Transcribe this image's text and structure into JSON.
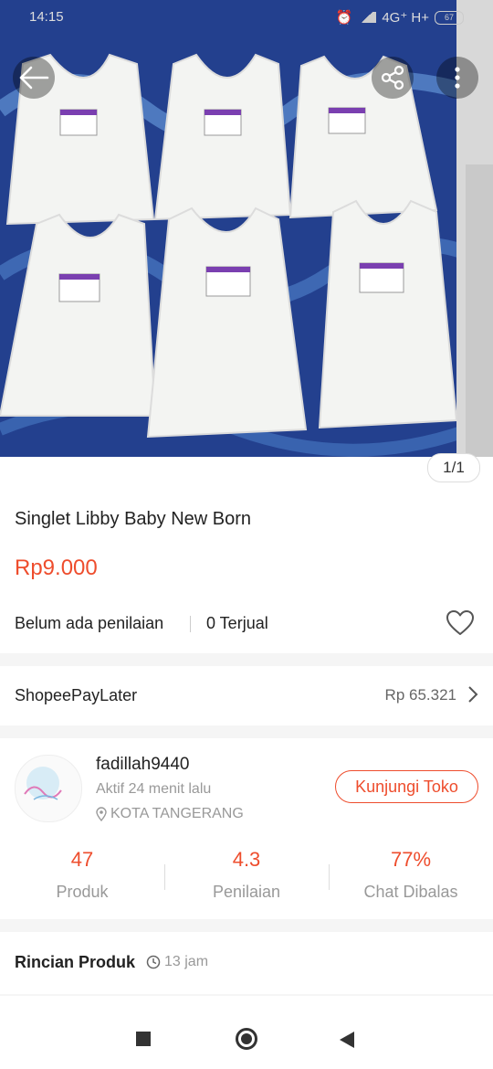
{
  "status_bar": {
    "time": "14:15",
    "network": "4G⁺ H+",
    "battery": "67"
  },
  "gallery": {
    "counter": "1/1"
  },
  "product": {
    "title": "Singlet Libby Baby New Born",
    "price": "Rp9.000",
    "rating_text": "Belum ada penilaian",
    "sold_text": "0 Terjual"
  },
  "paylater": {
    "label": "ShopeePayLater",
    "amount": "Rp 65.321"
  },
  "shop": {
    "name": "fadillah9440",
    "active": "Aktif 24 menit lalu",
    "location": "KOTA TANGERANG",
    "visit_label": "Kunjungi Toko",
    "stats": [
      {
        "value": "47",
        "label": "Produk"
      },
      {
        "value": "4.3",
        "label": "Penilaian"
      },
      {
        "value": "77%",
        "label": "Chat Dibalas"
      }
    ]
  },
  "details": {
    "title": "Rincian Produk",
    "time": "13 jam"
  },
  "colors": {
    "accent": "#ee4d2d"
  },
  "icons": [
    "back-arrow-icon",
    "share-icon",
    "more-vertical-icon",
    "heart-icon",
    "chevron-right-icon",
    "location-pin-icon",
    "clock-icon",
    "nav-square-icon",
    "nav-home-icon",
    "nav-back-icon"
  ]
}
